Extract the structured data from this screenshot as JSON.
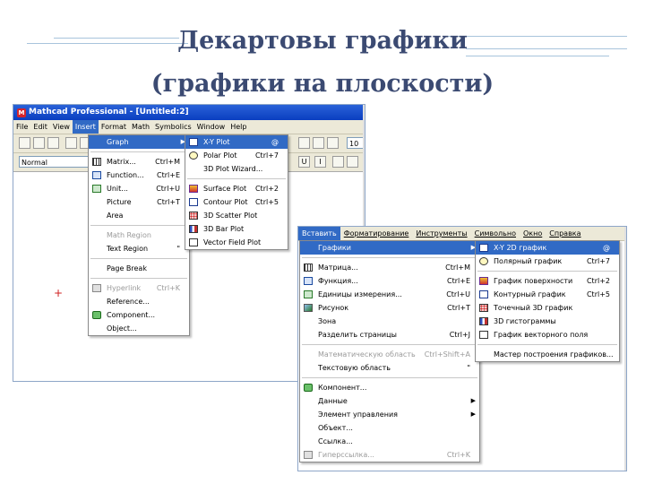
{
  "slide": {
    "title_line1": "Декартовы графики",
    "title_line2": "(графики на плоскости)"
  },
  "english_window": {
    "title": "Mathcad Professional - [Untitled:2]",
    "menubar": [
      "File",
      "Edit",
      "View",
      "Insert",
      "Format",
      "Math",
      "Symbolics",
      "Window",
      "Help"
    ],
    "active_menu": "Insert",
    "style_combo": "Normal",
    "toolbar_right_value": "10",
    "insert_menu": [
      {
        "label": "Graph",
        "shortcut": "",
        "submenu": true,
        "highlighted": true,
        "icon": "none"
      },
      {
        "sep": true
      },
      {
        "label": "Matrix...",
        "shortcut": "Ctrl+M",
        "icon": "matrix-icon"
      },
      {
        "label": "Function...",
        "shortcut": "Ctrl+E",
        "icon": "function-icon"
      },
      {
        "label": "Unit...",
        "shortcut": "Ctrl+U",
        "icon": "unit-icon"
      },
      {
        "label": "Picture",
        "shortcut": "Ctrl+T",
        "icon": "none"
      },
      {
        "label": "Area",
        "shortcut": "",
        "icon": "none"
      },
      {
        "sep": true
      },
      {
        "label": "Math Region",
        "shortcut": "",
        "disabled": true,
        "icon": "none"
      },
      {
        "label": "Text Region",
        "shortcut": "\"",
        "icon": "none"
      },
      {
        "sep": true
      },
      {
        "label": "Page Break",
        "shortcut": "",
        "icon": "none"
      },
      {
        "sep": true
      },
      {
        "label": "Hyperlink",
        "shortcut": "Ctrl+K",
        "disabled": true,
        "icon": "hyperlink-icon"
      },
      {
        "label": "Reference...",
        "shortcut": "",
        "icon": "none"
      },
      {
        "label": "Component...",
        "shortcut": "",
        "icon": "component-icon"
      },
      {
        "label": "Object...",
        "shortcut": "",
        "icon": "none"
      }
    ],
    "graph_submenu": [
      {
        "label": "X-Y Plot",
        "shortcut": "@",
        "highlighted": true,
        "icon": "xy-plot-icon"
      },
      {
        "label": "Polar Plot",
        "shortcut": "Ctrl+7",
        "icon": "polar-plot-icon"
      },
      {
        "label": "3D Plot Wizard...",
        "shortcut": "",
        "icon": "none"
      },
      {
        "sep": true
      },
      {
        "label": "Surface Plot",
        "shortcut": "Ctrl+2",
        "icon": "surface-plot-icon"
      },
      {
        "label": "Contour Plot",
        "shortcut": "Ctrl+5",
        "icon": "contour-plot-icon"
      },
      {
        "label": "3D Scatter Plot",
        "shortcut": "",
        "icon": "scatter-plot-icon"
      },
      {
        "label": "3D Bar Plot",
        "shortcut": "",
        "icon": "bar-plot-icon"
      },
      {
        "label": "Vector Field Plot",
        "shortcut": "",
        "icon": "vector-field-icon"
      }
    ],
    "cursor_glyph": "+"
  },
  "russian_window": {
    "menubar": [
      "Вставить",
      "Форматирование",
      "Инструменты",
      "Символьно",
      "Окно",
      "Справка"
    ],
    "active_menu": "Вставить",
    "insert_menu": [
      {
        "label": "Графики",
        "shortcut": "",
        "submenu": true,
        "highlighted": true,
        "icon": "none"
      },
      {
        "sep": true
      },
      {
        "label": "Матрица...",
        "shortcut": "Ctrl+M",
        "icon": "matrix-icon"
      },
      {
        "label": "Функция...",
        "shortcut": "Ctrl+E",
        "icon": "function-icon"
      },
      {
        "label": "Единицы измерения...",
        "shortcut": "Ctrl+U",
        "icon": "unit-icon"
      },
      {
        "label": "Рисунок",
        "shortcut": "Ctrl+T",
        "icon": "picture-icon"
      },
      {
        "label": "Зона",
        "shortcut": "",
        "icon": "none"
      },
      {
        "label": "Разделить страницы",
        "shortcut": "Ctrl+J",
        "icon": "none"
      },
      {
        "sep": true
      },
      {
        "label": "Математическую область",
        "shortcut": "Ctrl+Shift+A",
        "disabled": true,
        "icon": "none"
      },
      {
        "label": "Текстовую область",
        "shortcut": "\"",
        "icon": "none"
      },
      {
        "sep": true
      },
      {
        "label": "Компонент...",
        "shortcut": "",
        "icon": "component-icon"
      },
      {
        "label": "Данные",
        "shortcut": "",
        "submenu": true,
        "icon": "none"
      },
      {
        "label": "Элемент управления",
        "shortcut": "",
        "submenu": true,
        "icon": "none"
      },
      {
        "label": "Объект...",
        "shortcut": "",
        "icon": "none"
      },
      {
        "label": "Ссылка...",
        "shortcut": "",
        "icon": "none"
      },
      {
        "label": "Гиперссылка...",
        "shortcut": "Ctrl+K",
        "disabled": true,
        "icon": "hyperlink-icon"
      }
    ],
    "graph_submenu": [
      {
        "label": "X-Y 2D график",
        "shortcut": "@",
        "highlighted": true,
        "icon": "xy-plot-icon"
      },
      {
        "label": "Полярный график",
        "shortcut": "Ctrl+7",
        "icon": "polar-plot-icon"
      },
      {
        "sep": true
      },
      {
        "label": "График поверхности",
        "shortcut": "Ctrl+2",
        "icon": "surface-plot-icon"
      },
      {
        "label": "Контурный график",
        "shortcut": "Ctrl+5",
        "icon": "contour-plot-icon"
      },
      {
        "label": "Точечный 3D график",
        "shortcut": "",
        "icon": "scatter-plot-icon"
      },
      {
        "label": "3D гистограммы",
        "shortcut": "",
        "icon": "bar-plot-icon"
      },
      {
        "label": "График векторного поля",
        "shortcut": "",
        "icon": "vector-field-icon"
      },
      {
        "sep": true
      },
      {
        "label": "Мастер построения графиков...",
        "shortcut": "",
        "icon": "none"
      }
    ]
  },
  "colors": {
    "title_text": "#3b4a72",
    "menu_highlight": "#316ac5",
    "window_title_bar": "#0a3ec0"
  }
}
